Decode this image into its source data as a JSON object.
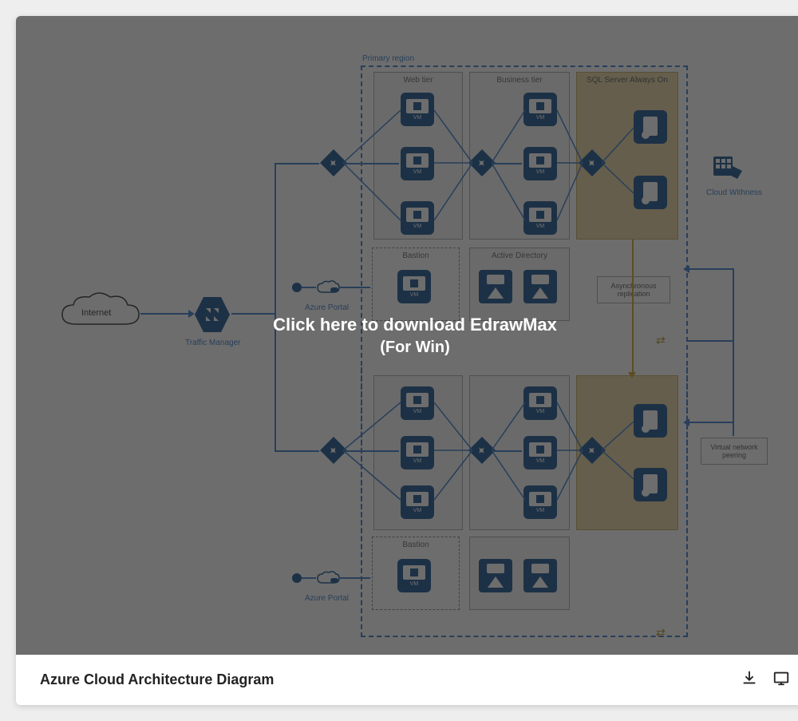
{
  "footer": {
    "title": "Azure Cloud Architecture Diagram"
  },
  "overlay": {
    "line1": "Click here to download EdrawMax",
    "line2": "(For Win)"
  },
  "dia": {
    "primary_region": "Primary region",
    "web_tier": "Web tier",
    "business_tier": "Business tier",
    "sql_tier": "SQL Server Always On",
    "bastion": "Bastion",
    "active_directory": "Active Directory",
    "internet": "Internet",
    "traffic_manager": "Traffic Manager",
    "azure_portal": "Azure Portal",
    "cloud_witness": "Cloud Withness",
    "async_replication": "Asynchronous replication",
    "vnet_peering": "Virtual network peering",
    "vm": "VM"
  }
}
